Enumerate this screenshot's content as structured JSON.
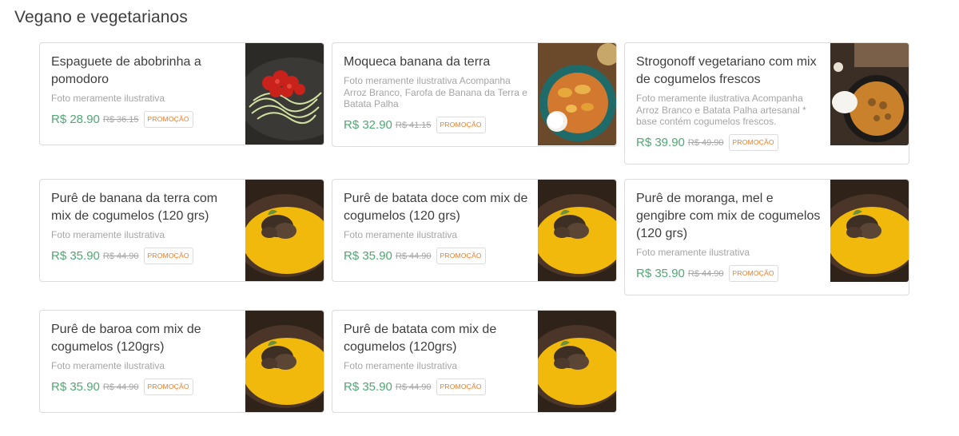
{
  "section": {
    "title": "Vegano e vegetarianos"
  },
  "products": [
    {
      "name": "Espaguete de abobrinha a pomodoro",
      "description": "Foto meramente ilustrativa",
      "price": "R$ 28.90",
      "old_price": "R$ 36.15",
      "badge": "PROMOÇÃO",
      "image": "zucchini-pomodoro-photo"
    },
    {
      "name": "Moqueca banana da terra",
      "description": "Foto meramente ilustrativa Acompanha Arroz Branco, Farofa de Banana da Terra e Batata Palha",
      "price": "R$ 32.90",
      "old_price": "R$ 41.15",
      "badge": "PROMOÇÃO",
      "image": "moqueca-photo"
    },
    {
      "name": "Strogonoff vegetariano com mix de cogumelos frescos",
      "description": "Foto meramente ilustrativa Acompanha Arroz Branco e Batata Palha artesanal * base contém cogumelos frescos.",
      "price": "R$ 39.90",
      "old_price": "R$ 49.90",
      "badge": "PROMOÇÃO",
      "image": "strogonoff-photo"
    },
    {
      "name": "Purê de banana da terra com mix de cogumelos (120 grs)",
      "description": "Foto meramente ilustrativa",
      "price": "R$ 35.90",
      "old_price": "R$ 44.90",
      "badge": "PROMOÇÃO",
      "image": "pure-mushroom-photo"
    },
    {
      "name": "Purê de batata doce com mix de cogumelos (120 grs)",
      "description": "Foto meramente ilustrativa",
      "price": "R$ 35.90",
      "old_price": "R$ 44.90",
      "badge": "PROMOÇÃO",
      "image": "pure-mushroom-photo"
    },
    {
      "name": "Purê de moranga, mel e gengibre com mix de cogumelos (120 grs)",
      "description": "Foto meramente ilustrativa",
      "price": "R$ 35.90",
      "old_price": "R$ 44.90",
      "badge": "PROMOÇÃO",
      "image": "pure-mushroom-photo"
    },
    {
      "name": "Purê de baroa com mix de cogumelos (120grs)",
      "description": "Foto meramente ilustrativa",
      "price": "R$ 35.90",
      "old_price": "R$ 44.90",
      "badge": "PROMOÇÃO",
      "image": "pure-mushroom-photo"
    },
    {
      "name": "Purê de batata com mix de cogumelos (120grs)",
      "description": "Foto meramente ilustrativa",
      "price": "R$ 35.90",
      "old_price": "R$ 44.90",
      "badge": "PROMOÇÃO",
      "image": "pure-mushroom-photo"
    }
  ],
  "colors": {
    "price": "#50a773",
    "promo": "#ea7c28",
    "muted": "#a6a5a5",
    "text": "#3f3e3e",
    "border": "#dcdcdc"
  }
}
